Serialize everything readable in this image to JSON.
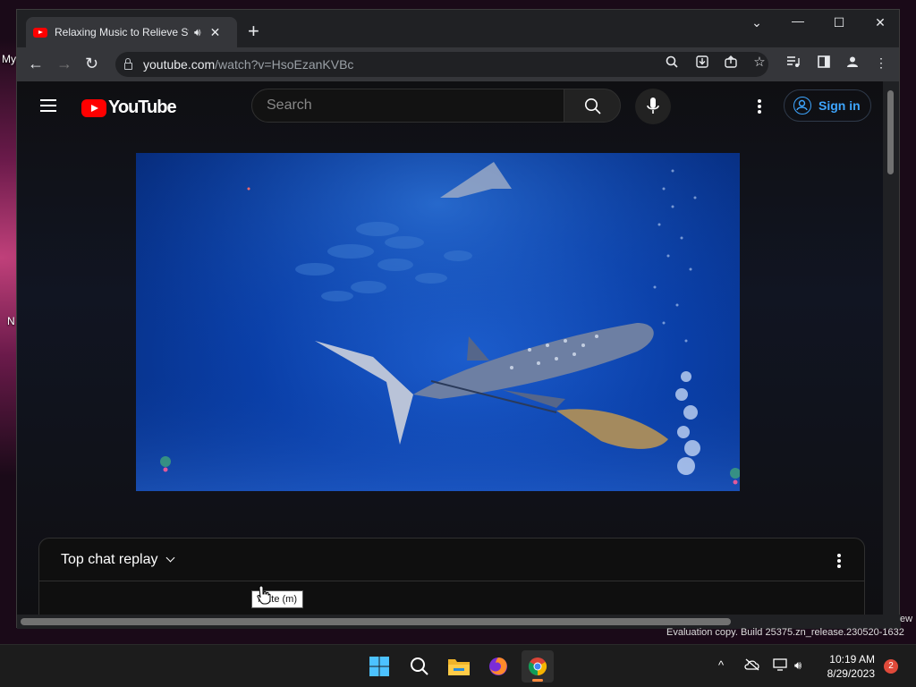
{
  "desktop": {
    "label_top": "My",
    "label_mid": "N"
  },
  "browser": {
    "tab_title": "Relaxing Music to Relieve Stress",
    "new_tab": "+",
    "url_host": "youtube.com",
    "url_path": "/watch?v=HsoEzanKVBc"
  },
  "youtube": {
    "logo_text": "YouTube",
    "search_placeholder": "Search",
    "sign_in": "Sign in",
    "chat_title": "Top chat replay",
    "tooltip": "Mute (m)"
  },
  "watermark": "Evaluation copy. Build 25375.zn_release.230520-1632",
  "new_label": "ew",
  "taskbar": {
    "time": "10:19 AM",
    "date": "8/29/2023",
    "notifications": "2"
  },
  "colors": {
    "accent": "#3ea6ff",
    "brand": "#ff0000",
    "page_bg": "#0f0f0f"
  }
}
